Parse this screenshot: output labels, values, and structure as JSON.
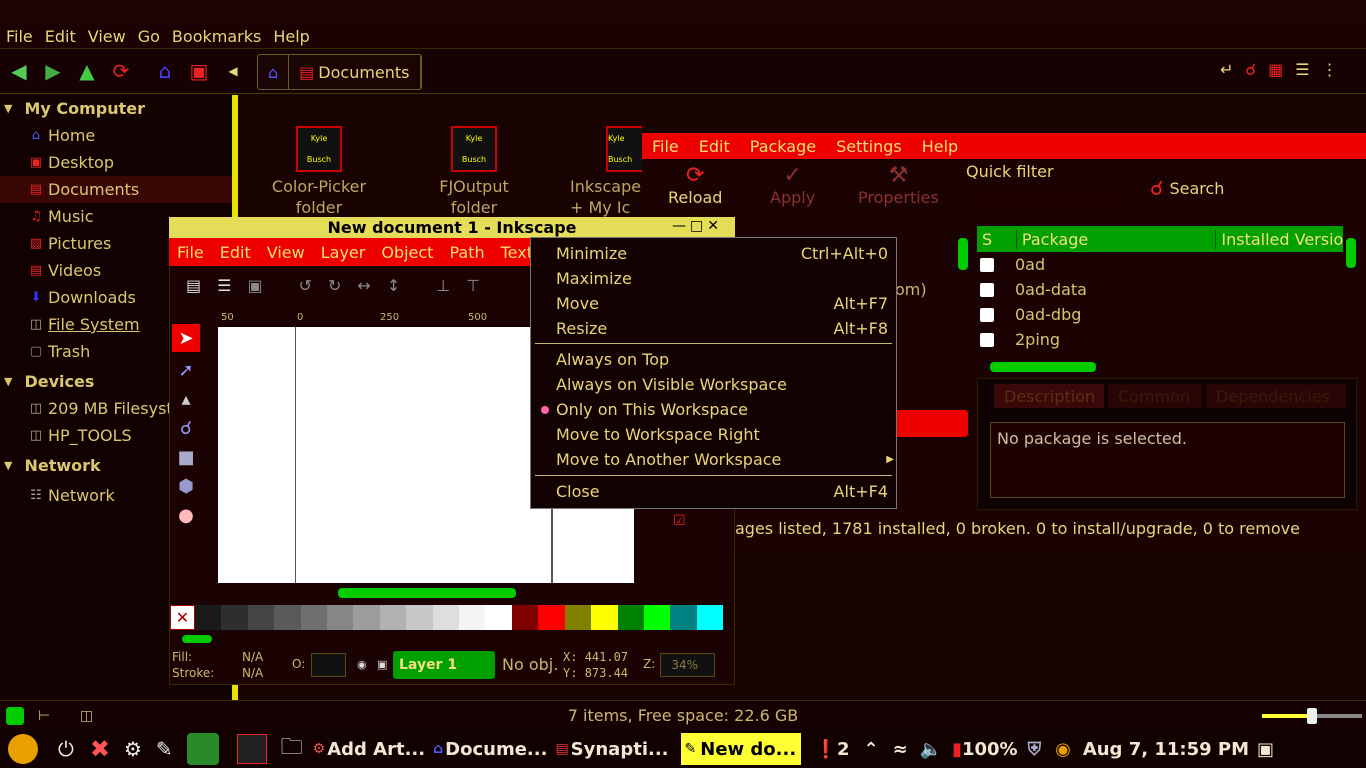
{
  "fm": {
    "menu": [
      "File",
      "Edit",
      "View",
      "Go",
      "Bookmarks",
      "Help"
    ],
    "breadcrumb": "Documents",
    "sidebar": {
      "my_computer": "My Computer",
      "items": [
        "Home",
        "Desktop",
        "Documents",
        "Music",
        "Pictures",
        "Videos",
        "Downloads",
        "File System",
        "Trash"
      ],
      "devices": "Devices",
      "device_items": [
        "209 MB Filesyst",
        "HP_TOOLS"
      ],
      "network": "Network",
      "network_items": [
        "Network"
      ]
    },
    "files": [
      {
        "name1": "Color-Picker",
        "name2": "folder",
        "thumb": "Kyle Busch"
      },
      {
        "name1": "FJOutput",
        "name2": "folder",
        "thumb": "Kyle Busch"
      },
      {
        "name1": "Inkscape",
        "name2": "+ My Ic",
        "thumb": "Kyle Busch"
      }
    ],
    "status": "7 items, Free space: 22.6 GB"
  },
  "synaptic": {
    "menu": [
      "File",
      "Edit",
      "Package",
      "Settings",
      "Help"
    ],
    "tools": [
      "Reload",
      "Apply",
      "Properties"
    ],
    "quick_filter": "Quick filter",
    "search": "Search",
    "columns": [
      "S",
      "Package",
      "Installed Versio"
    ],
    "packages": [
      "0ad",
      "0ad-data",
      "0ad-dbg",
      "2ping"
    ],
    "tabs": [
      "Description",
      "Common",
      "Dependencies"
    ],
    "partial_text": "om)",
    "desc": "No package is selected.",
    "status": "ages listed, 1781 installed, 0 broken. 0 to install/upgrade, 0 to remove"
  },
  "inkscape": {
    "title": "New document 1 - Inkscape",
    "menu": [
      "File",
      "Edit",
      "View",
      "Layer",
      "Object",
      "Path",
      "Text"
    ],
    "ruler": [
      "50",
      "0",
      "250",
      "500"
    ],
    "fill_label": "Fill:",
    "fill_val": "N/A",
    "stroke_label": "Stroke:",
    "stroke_val": "N/A",
    "opacity_label": "O:",
    "layer": "Layer 1",
    "noobj": "No obj.",
    "x_label": "X:",
    "x_val": "441.07",
    "y_label": "Y:",
    "y_val": "873.44",
    "z_label": "Z:",
    "z_val": "34%",
    "palette": [
      "#1a1a1a",
      "#2e2e2e",
      "#444444",
      "#5a5a5a",
      "#707070",
      "#868686",
      "#9c9c9c",
      "#b2b2b2",
      "#c8c8c8",
      "#dedede",
      "#f4f4f4",
      "#ffffff",
      "#800000",
      "#ff0000",
      "#808000",
      "#ffff00",
      "#008000",
      "#00ff00",
      "#008080",
      "#00ffff"
    ]
  },
  "context_menu": {
    "items": [
      {
        "label": "Minimize",
        "shortcut": "Ctrl+Alt+0"
      },
      {
        "label": "Maximize",
        "shortcut": ""
      },
      {
        "label": "Move",
        "shortcut": "Alt+F7"
      },
      {
        "label": "Resize",
        "shortcut": "Alt+F8"
      },
      {
        "label": "Always on Top",
        "shortcut": ""
      },
      {
        "label": "Always on Visible Workspace",
        "shortcut": ""
      },
      {
        "label": "Only on This Workspace",
        "shortcut": ""
      },
      {
        "label": "Move to Workspace Right",
        "shortcut": ""
      },
      {
        "label": "Move to Another Workspace",
        "shortcut": ""
      },
      {
        "label": "Close",
        "shortcut": "Alt+F4"
      }
    ]
  },
  "taskbar": {
    "tasks": [
      "Add  Art...",
      "Docume...",
      "Synapti...",
      "New do..."
    ],
    "notif": "2",
    "battery": "100%",
    "clock": "Aug  7, 11:59 PM"
  },
  "colors": {
    "accent_red": "#ee0000",
    "accent_green": "#00a000",
    "accent_yellow": "#e8e000",
    "text": "#e8d57a"
  }
}
